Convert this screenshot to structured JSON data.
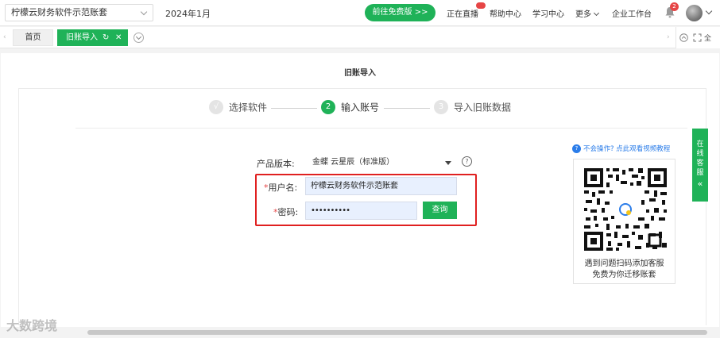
{
  "header": {
    "account_name": "柠檬云财务软件示范账套",
    "period": "2024年1月",
    "trial_button": "前往免费版 >>",
    "links": {
      "live": "正在直播",
      "help": "帮助中心",
      "learn": "学习中心",
      "more": "更多",
      "workbench": "企业工作台"
    },
    "notification_count": "2"
  },
  "tabs": {
    "home": "首页",
    "active": "旧账导入",
    "right_label": "全"
  },
  "page": {
    "title": "旧账导入",
    "steps": [
      {
        "num": "√",
        "label": "选择软件",
        "state": "done"
      },
      {
        "num": "2",
        "label": "输入账号",
        "state": "current"
      },
      {
        "num": "3",
        "label": "导入旧账数据",
        "state": "todo"
      }
    ],
    "form": {
      "version_label": "产品版本:",
      "version_value": "金蝶 云星辰（标准版）",
      "username_label": "用户名:",
      "username_value": "柠檬云财务软件示范账套",
      "password_label": "密码:",
      "password_value": "••••••••••",
      "required_mark": "*",
      "query_button": "查询"
    },
    "help_link": "不会操作? 点此观看视频教程",
    "qr_caption_line1": "遇到问题扫码添加客服",
    "qr_caption_line2": "免费为你迁移账套",
    "side_tab": "在线客服"
  },
  "watermark": "大数跨境",
  "colors": {
    "brand_green": "#1fb258",
    "highlight_red": "#e02020",
    "link_blue": "#2b7de9"
  }
}
